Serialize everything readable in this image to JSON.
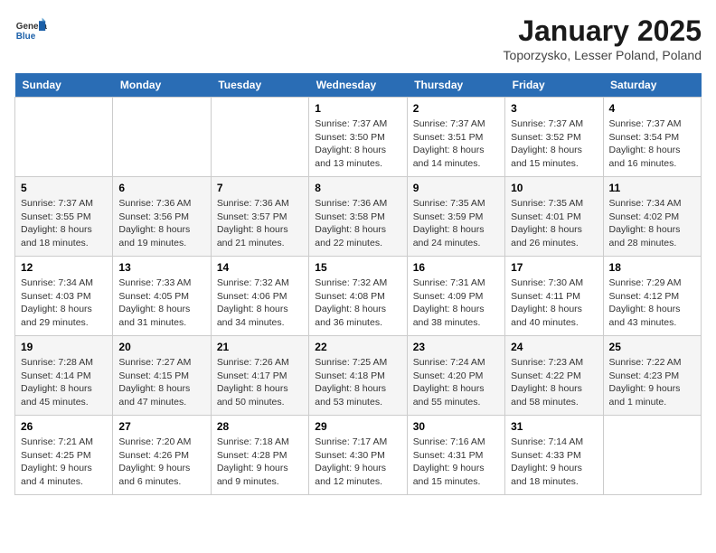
{
  "header": {
    "logo_general": "General",
    "logo_blue": "Blue",
    "month_title": "January 2025",
    "subtitle": "Toporzysko, Lesser Poland, Poland"
  },
  "weekdays": [
    "Sunday",
    "Monday",
    "Tuesday",
    "Wednesday",
    "Thursday",
    "Friday",
    "Saturday"
  ],
  "weeks": [
    [
      {
        "day": "",
        "info": ""
      },
      {
        "day": "",
        "info": ""
      },
      {
        "day": "",
        "info": ""
      },
      {
        "day": "1",
        "info": "Sunrise: 7:37 AM\nSunset: 3:50 PM\nDaylight: 8 hours\nand 13 minutes."
      },
      {
        "day": "2",
        "info": "Sunrise: 7:37 AM\nSunset: 3:51 PM\nDaylight: 8 hours\nand 14 minutes."
      },
      {
        "day": "3",
        "info": "Sunrise: 7:37 AM\nSunset: 3:52 PM\nDaylight: 8 hours\nand 15 minutes."
      },
      {
        "day": "4",
        "info": "Sunrise: 7:37 AM\nSunset: 3:54 PM\nDaylight: 8 hours\nand 16 minutes."
      }
    ],
    [
      {
        "day": "5",
        "info": "Sunrise: 7:37 AM\nSunset: 3:55 PM\nDaylight: 8 hours\nand 18 minutes."
      },
      {
        "day": "6",
        "info": "Sunrise: 7:36 AM\nSunset: 3:56 PM\nDaylight: 8 hours\nand 19 minutes."
      },
      {
        "day": "7",
        "info": "Sunrise: 7:36 AM\nSunset: 3:57 PM\nDaylight: 8 hours\nand 21 minutes."
      },
      {
        "day": "8",
        "info": "Sunrise: 7:36 AM\nSunset: 3:58 PM\nDaylight: 8 hours\nand 22 minutes."
      },
      {
        "day": "9",
        "info": "Sunrise: 7:35 AM\nSunset: 3:59 PM\nDaylight: 8 hours\nand 24 minutes."
      },
      {
        "day": "10",
        "info": "Sunrise: 7:35 AM\nSunset: 4:01 PM\nDaylight: 8 hours\nand 26 minutes."
      },
      {
        "day": "11",
        "info": "Sunrise: 7:34 AM\nSunset: 4:02 PM\nDaylight: 8 hours\nand 28 minutes."
      }
    ],
    [
      {
        "day": "12",
        "info": "Sunrise: 7:34 AM\nSunset: 4:03 PM\nDaylight: 8 hours\nand 29 minutes."
      },
      {
        "day": "13",
        "info": "Sunrise: 7:33 AM\nSunset: 4:05 PM\nDaylight: 8 hours\nand 31 minutes."
      },
      {
        "day": "14",
        "info": "Sunrise: 7:32 AM\nSunset: 4:06 PM\nDaylight: 8 hours\nand 34 minutes."
      },
      {
        "day": "15",
        "info": "Sunrise: 7:32 AM\nSunset: 4:08 PM\nDaylight: 8 hours\nand 36 minutes."
      },
      {
        "day": "16",
        "info": "Sunrise: 7:31 AM\nSunset: 4:09 PM\nDaylight: 8 hours\nand 38 minutes."
      },
      {
        "day": "17",
        "info": "Sunrise: 7:30 AM\nSunset: 4:11 PM\nDaylight: 8 hours\nand 40 minutes."
      },
      {
        "day": "18",
        "info": "Sunrise: 7:29 AM\nSunset: 4:12 PM\nDaylight: 8 hours\nand 43 minutes."
      }
    ],
    [
      {
        "day": "19",
        "info": "Sunrise: 7:28 AM\nSunset: 4:14 PM\nDaylight: 8 hours\nand 45 minutes."
      },
      {
        "day": "20",
        "info": "Sunrise: 7:27 AM\nSunset: 4:15 PM\nDaylight: 8 hours\nand 47 minutes."
      },
      {
        "day": "21",
        "info": "Sunrise: 7:26 AM\nSunset: 4:17 PM\nDaylight: 8 hours\nand 50 minutes."
      },
      {
        "day": "22",
        "info": "Sunrise: 7:25 AM\nSunset: 4:18 PM\nDaylight: 8 hours\nand 53 minutes."
      },
      {
        "day": "23",
        "info": "Sunrise: 7:24 AM\nSunset: 4:20 PM\nDaylight: 8 hours\nand 55 minutes."
      },
      {
        "day": "24",
        "info": "Sunrise: 7:23 AM\nSunset: 4:22 PM\nDaylight: 8 hours\nand 58 minutes."
      },
      {
        "day": "25",
        "info": "Sunrise: 7:22 AM\nSunset: 4:23 PM\nDaylight: 9 hours\nand 1 minute."
      }
    ],
    [
      {
        "day": "26",
        "info": "Sunrise: 7:21 AM\nSunset: 4:25 PM\nDaylight: 9 hours\nand 4 minutes."
      },
      {
        "day": "27",
        "info": "Sunrise: 7:20 AM\nSunset: 4:26 PM\nDaylight: 9 hours\nand 6 minutes."
      },
      {
        "day": "28",
        "info": "Sunrise: 7:18 AM\nSunset: 4:28 PM\nDaylight: 9 hours\nand 9 minutes."
      },
      {
        "day": "29",
        "info": "Sunrise: 7:17 AM\nSunset: 4:30 PM\nDaylight: 9 hours\nand 12 minutes."
      },
      {
        "day": "30",
        "info": "Sunrise: 7:16 AM\nSunset: 4:31 PM\nDaylight: 9 hours\nand 15 minutes."
      },
      {
        "day": "31",
        "info": "Sunrise: 7:14 AM\nSunset: 4:33 PM\nDaylight: 9 hours\nand 18 minutes."
      },
      {
        "day": "",
        "info": ""
      }
    ]
  ]
}
